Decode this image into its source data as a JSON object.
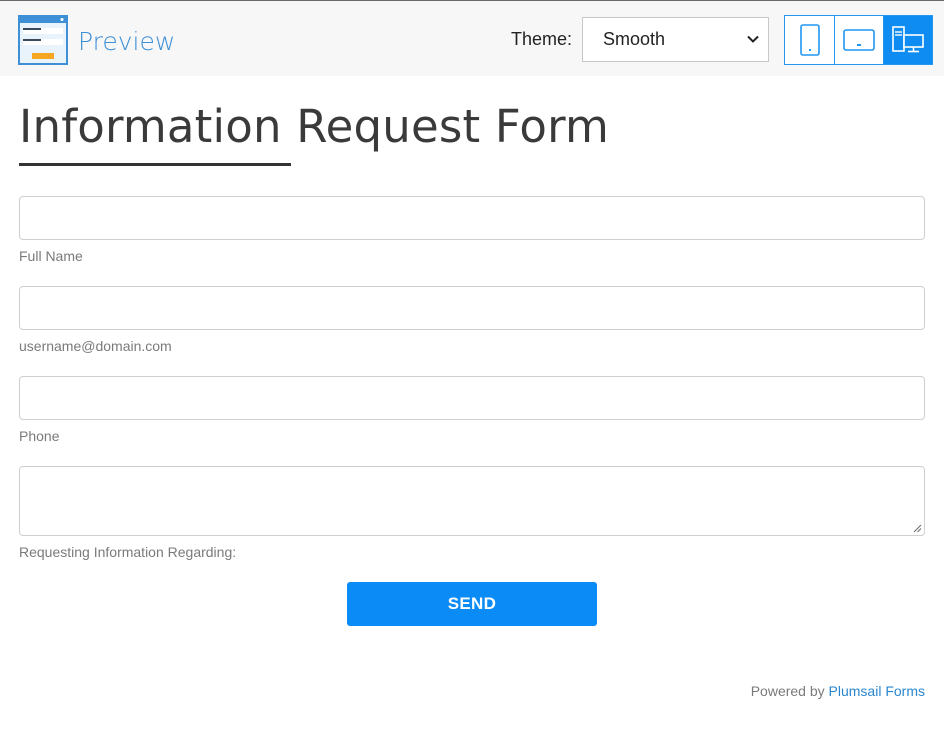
{
  "app": {
    "title": "Preview",
    "theme_label": "Theme:",
    "theme_value": "Smooth",
    "device_modes": [
      "phone",
      "tablet",
      "desktop"
    ],
    "active_device": "desktop",
    "accent_color": "#0e8cf2"
  },
  "form": {
    "title": "Information Request Form",
    "fields": [
      {
        "label": "Full Name",
        "value": ""
      },
      {
        "label": "username@domain.com",
        "value": ""
      },
      {
        "label": "Phone",
        "value": ""
      },
      {
        "label": "Requesting Information Regarding:",
        "value": ""
      }
    ],
    "submit_label": "SEND"
  },
  "footer": {
    "prefix": "Powered by",
    "link_text": "Plumsail Forms"
  }
}
